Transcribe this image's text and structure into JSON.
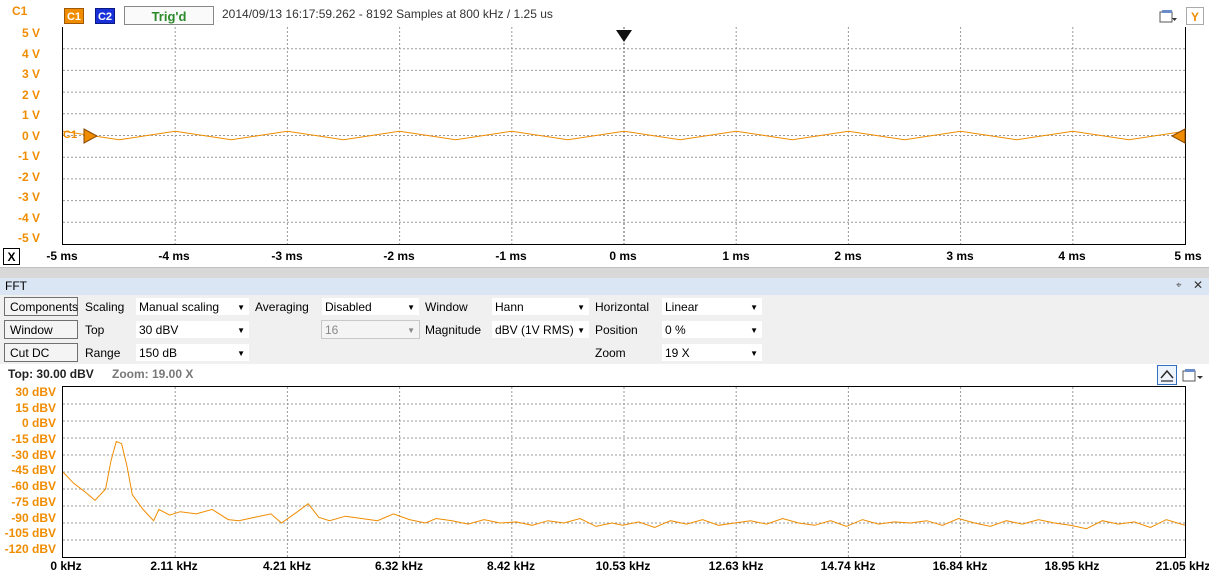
{
  "scope": {
    "channel_label": "C1",
    "channel_buttons": [
      "C1",
      "C2"
    ],
    "trigger_status": "Trig'd",
    "info": "2014/09/13 16:17:59.262 - 8192 Samples at 800 kHz / 1.25 us",
    "y_button": "Y",
    "trace_marker": "C1",
    "close_label": "X",
    "y_labels": [
      "5 V",
      "4 V",
      "3 V",
      "2 V",
      "1 V",
      "0 V",
      "-1 V",
      "-2 V",
      "-3 V",
      "-4 V",
      "-5 V"
    ],
    "x_labels": [
      "-5 ms",
      "-4 ms",
      "-3 ms",
      "-2 ms",
      "-1 ms",
      "0 ms",
      "1 ms",
      "2 ms",
      "3 ms",
      "4 ms",
      "5 ms"
    ],
    "colors": {
      "trace": "#f08c00",
      "c1_button": "#f08c00",
      "c2_button": "#1830d8",
      "trig_text": "#2a8a2a"
    }
  },
  "fft": {
    "title": "FFT",
    "buttons": [
      "Components",
      "Window",
      "Cut DC"
    ],
    "scaling_label": "Scaling",
    "scaling_value": "Manual scaling",
    "top_label": "Top",
    "top_value": "30 dBV",
    "range_label": "Range",
    "range_value": "150 dB",
    "averaging_label": "Averaging",
    "averaging_value": "Disabled",
    "averaging_count": "16",
    "window_label": "Window",
    "window_value": "Hann",
    "magnitude_label": "Magnitude",
    "magnitude_value": "dBV (1V RMS)",
    "horizontal_label": "Horizontal",
    "horizontal_value": "Linear",
    "position_label": "Position",
    "position_value": "0 %",
    "zoom_label": "Zoom",
    "zoom_value": "19 X",
    "status_top": "Top: 30.00 dBV",
    "status_zoom": "Zoom: 19.00 X",
    "y_labels": [
      "30 dBV",
      "15 dBV",
      "0 dBV",
      "-15 dBV",
      "-30 dBV",
      "-45 dBV",
      "-60 dBV",
      "-75 dBV",
      "-90 dBV",
      "-105 dBV",
      "-120 dBV"
    ],
    "x_labels": [
      "0 kHz",
      "2.11 kHz",
      "4.21 kHz",
      "6.32 kHz",
      "8.42 kHz",
      "10.53 kHz",
      "12.63 kHz",
      "14.74 kHz",
      "16.84 kHz",
      "18.95 kHz",
      "21.05 kHz"
    ]
  },
  "chart_data": [
    {
      "type": "line",
      "x_unit": "ms",
      "xlim": [
        -5,
        5
      ],
      "ylim": [
        -5,
        5
      ],
      "y_unit": "V",
      "grid": true,
      "series": [
        {
          "name": "C1",
          "x": [
            -5,
            -4.75,
            -4.5,
            -4.25,
            -4,
            -3.75,
            -3.5,
            -3.25,
            -3,
            -2.75,
            -2.5,
            -2.25,
            -2,
            -1.75,
            -1.5,
            -1.25,
            -1,
            -0.75,
            -0.5,
            -0.25,
            0,
            0.25,
            0.5,
            0.75,
            1,
            1.25,
            1.5,
            1.75,
            2,
            2.25,
            2.5,
            2.75,
            3,
            3.25,
            3.5,
            3.75,
            4,
            4.25,
            4.5,
            4.75,
            5
          ],
          "y": [
            0.2,
            0,
            -0.2,
            0,
            0.2,
            0,
            -0.2,
            0,
            0.2,
            0,
            -0.2,
            0,
            0.2,
            0,
            -0.2,
            0,
            0.2,
            0,
            -0.2,
            0,
            0.2,
            0,
            -0.2,
            0,
            0.2,
            0,
            -0.2,
            0,
            0.2,
            0,
            -0.2,
            0,
            0.2,
            0,
            -0.2,
            0,
            0.2,
            0,
            -0.2,
            0,
            0.2
          ]
        }
      ]
    },
    {
      "type": "line",
      "x_unit": "kHz",
      "xlim": [
        0,
        21.05
      ],
      "ylim": [
        -120,
        30
      ],
      "y_unit": "dBV",
      "grid": true,
      "series": [
        {
          "name": "FFT",
          "x": [
            0,
            0.2,
            0.4,
            0.6,
            0.8,
            0.9,
            1.0,
            1.1,
            1.2,
            1.3,
            1.5,
            1.7,
            1.8,
            2.0,
            2.2,
            2.5,
            2.8,
            3.1,
            3.3,
            3.6,
            3.9,
            4.1,
            4.4,
            4.6,
            4.8,
            5.0,
            5.3,
            5.6,
            5.9,
            6.2,
            6.5,
            6.8,
            7.0,
            7.3,
            7.6,
            7.9,
            8.2,
            8.5,
            8.8,
            9.1,
            9.4,
            9.7,
            10.0,
            10.3,
            10.5,
            10.8,
            11.1,
            11.4,
            11.7,
            12.0,
            12.3,
            12.6,
            12.9,
            13.2,
            13.5,
            13.8,
            14.1,
            14.4,
            14.7,
            15.0,
            15.3,
            15.6,
            15.9,
            16.2,
            16.5,
            16.8,
            17.1,
            17.4,
            17.7,
            18.0,
            18.3,
            18.6,
            18.9,
            19.2,
            19.5,
            19.8,
            20.1,
            20.4,
            20.7,
            21.05
          ],
          "y": [
            -45,
            -55,
            -62,
            -70,
            -60,
            -35,
            -18,
            -20,
            -40,
            -65,
            -78,
            -88,
            -78,
            -83,
            -80,
            -82,
            -78,
            -87,
            -88,
            -85,
            -82,
            -90,
            -80,
            -73,
            -85,
            -88,
            -84,
            -86,
            -88,
            -82,
            -87,
            -90,
            -86,
            -88,
            -91,
            -87,
            -90,
            -89,
            -92,
            -88,
            -90,
            -86,
            -93,
            -90,
            -92,
            -89,
            -94,
            -88,
            -91,
            -87,
            -92,
            -90,
            -88,
            -91,
            -86,
            -90,
            -92,
            -88,
            -93,
            -87,
            -91,
            -89,
            -90,
            -88,
            -92,
            -86,
            -90,
            -93,
            -88,
            -91,
            -87,
            -90,
            -92,
            -95,
            -88,
            -91,
            -89,
            -94,
            -87,
            -92
          ]
        }
      ]
    }
  ]
}
